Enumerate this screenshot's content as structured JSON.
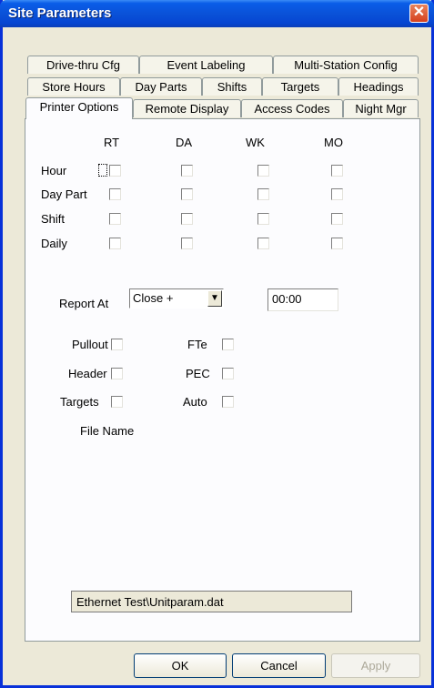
{
  "window": {
    "title": "Site Parameters",
    "close_glyph": "✕"
  },
  "tabs": {
    "row1": [
      "Drive-thru Cfg",
      "Event Labeling",
      "Multi-Station Config"
    ],
    "row2": [
      "Store Hours",
      "Day Parts",
      "Shifts",
      "Targets",
      "Headings"
    ],
    "row3": [
      "Printer Options",
      "Remote Display",
      "Access Codes",
      "Night Mgr"
    ],
    "active": "Printer Options"
  },
  "grid": {
    "columns": [
      "RT",
      "DA",
      "WK",
      "MO"
    ],
    "rows": [
      "Hour",
      "Day Part",
      "Shift",
      "Daily"
    ],
    "checked": [
      [
        false,
        false,
        false,
        false
      ],
      [
        false,
        false,
        false,
        false
      ],
      [
        false,
        false,
        false,
        false
      ],
      [
        false,
        false,
        false,
        false
      ]
    ]
  },
  "report": {
    "label": "Report At",
    "combo_value": "Close +",
    "combo_arrow": "▼",
    "time_value": "00:00"
  },
  "options_left": [
    {
      "label": "Pullout",
      "checked": false
    },
    {
      "label": "Header",
      "checked": false
    },
    {
      "label": "Targets",
      "checked": false
    }
  ],
  "options_right": [
    {
      "label": "FTe",
      "checked": false
    },
    {
      "label": "PEC",
      "checked": false
    },
    {
      "label": "Auto",
      "checked": false
    }
  ],
  "file": {
    "label": "File Name",
    "value": "Ethernet Test\\Unitparam.dat"
  },
  "buttons": {
    "ok": "OK",
    "cancel": "Cancel",
    "apply": "Apply"
  },
  "colors": {
    "title_bar": "#0a52d8",
    "frame": "#0831d9",
    "dialog_bg": "#ece9d8",
    "close": "#d6411e"
  }
}
